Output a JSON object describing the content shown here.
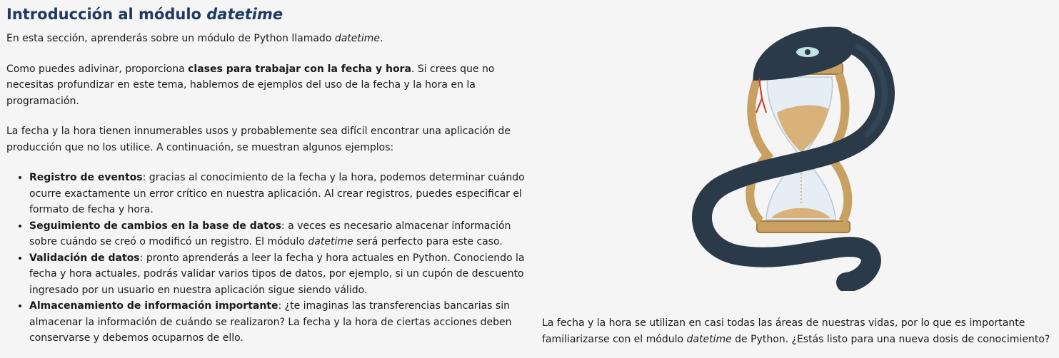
{
  "section": {
    "title_prefix": "Introducción al módulo ",
    "title_italic": "datetime"
  },
  "intro": {
    "before": "En esta sección, aprenderás sobre un módulo de Python llamado ",
    "italic": "datetime",
    "after": "."
  },
  "para2": {
    "before": "Como puedes adivinar, proporciona ",
    "bold": "clases para trabajar con la fecha y hora",
    "after": ". Si crees que no necesitas profundizar en este tema, hablemos de ejemplos del uso de la fecha y la hora en la programación."
  },
  "para3": "La fecha y la hora tienen innumerables usos y probablemente sea difícil encontrar una aplicación de producción que no los utilice. A continuación, se muestran algunos ejemplos:",
  "bullets": [
    {
      "bold": "Registro de eventos",
      "text": ": gracias al conocimiento de la fecha y la hora, podemos determinar cuándo ocurre exactamente un error crítico en nuestra aplicación. Al crear registros, puedes especificar el formato de fecha y hora."
    },
    {
      "bold": "Seguimiento de cambios en la base de datos",
      "text_before": ": a veces es necesario almacenar información sobre cuándo se creó o modificó un registro. El módulo ",
      "italic": "datetime",
      "text_after": " será perfecto para este caso."
    },
    {
      "bold": "Validación de datos",
      "text": ": pronto aprenderás a leer la fecha y hora actuales en Python. Conociendo la fecha y hora actuales, podrás validar varios tipos de datos, por ejemplo, si un cupón de descuento ingresado por un usuario en nuestra aplicación sigue siendo válido."
    },
    {
      "bold": "Almacenamiento de información importante",
      "text": ": ¿te imaginas las transferencias bancarias sin almacenar la información de cuándo se realizaron? La fecha y la hora de ciertas acciones deben conservarse y debemos ocuparnos de ello."
    }
  ],
  "closing": {
    "before": "La fecha y la hora se utilizan en casi todas las áreas de nuestras vidas, por lo que es importante familiarizarse con el módulo ",
    "italic": "datetime",
    "after": " de Python. ¿Estás listo para una nueva dosis de conocimiento?"
  },
  "colors": {
    "title": "#1e3a63",
    "snake": "#2a3a48",
    "hourglass_frame": "#c7a062",
    "sand": "#d9b27a",
    "glass": "#e6eef5"
  },
  "illustration_icon": "snake-hourglass-icon"
}
